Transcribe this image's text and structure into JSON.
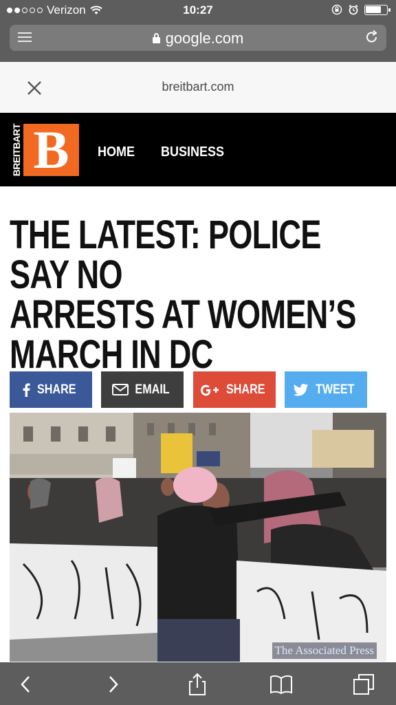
{
  "status_bar": {
    "carrier": "Verizon",
    "time": "10:27",
    "signal_dots_filled": 2,
    "signal_dots_total": 5,
    "battery_level": 0.75
  },
  "url_bar": {
    "domain": "google.com",
    "menu_icon": "reader-list-icon",
    "reload_icon": "reload-icon"
  },
  "amp_header": {
    "source_domain": "breitbart.com",
    "close_icon": "close-icon"
  },
  "site_nav": {
    "logo_side_text": "BREITBART",
    "logo_letter": "B",
    "links": [
      "HOME",
      "BUSINESS"
    ]
  },
  "article": {
    "headline_lines": [
      "THE LATEST: POLICE SAY NO",
      "ARRESTS AT WOMEN’S",
      "MARCH IN DC"
    ],
    "photo_credit": "The Associated Press"
  },
  "share_buttons": {
    "facebook": "SHARE",
    "email": "EMAIL",
    "google_plus": "SHARE",
    "twitter": "TWEET"
  },
  "colors": {
    "facebook": "#3b5998",
    "email": "#3e3e3e",
    "google_plus": "#dd4b39",
    "twitter": "#55acee",
    "brand_orange": "#f26a21"
  },
  "toolbar": {
    "icons": [
      "back-icon",
      "forward-icon",
      "share-icon",
      "bookmarks-icon",
      "tabs-icon"
    ]
  }
}
